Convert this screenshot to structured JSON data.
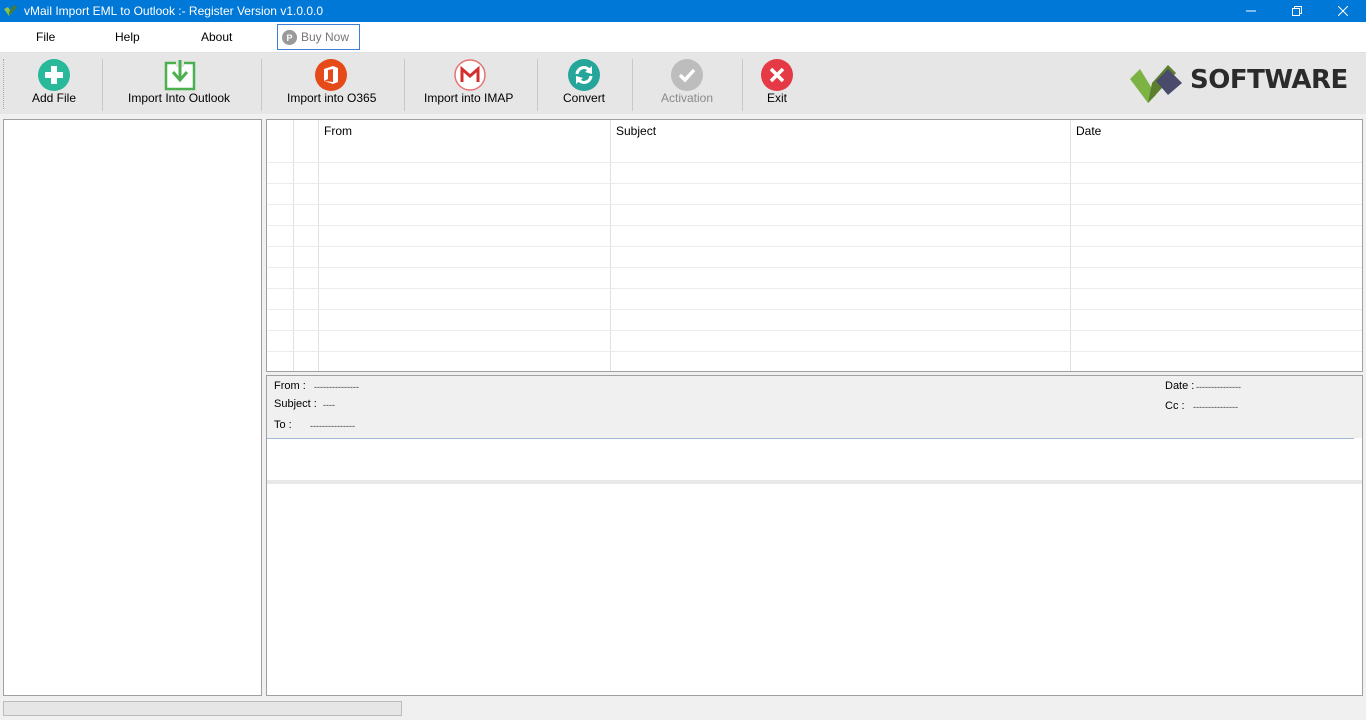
{
  "window": {
    "title": "vMail Import EML to Outlook :- Register Version v1.0.0.0",
    "accent": "#0078d7"
  },
  "menu": {
    "file": "File",
    "help": "Help",
    "about": "About",
    "buy_now": "Buy Now"
  },
  "toolbar": {
    "add_file": "Add File",
    "import_outlook": "Import Into Outlook",
    "import_o365": "Import into O365",
    "import_imap": "Import into IMAP",
    "convert": "Convert",
    "activation": "Activation",
    "exit": "Exit"
  },
  "brand": {
    "logo_text": "SOFTWARE"
  },
  "grid": {
    "columns": [
      "From",
      "Subject",
      "Date"
    ]
  },
  "preview": {
    "from_label": "From :",
    "from_value": "---------------",
    "subject_label": "Subject :",
    "subject_value": "----",
    "to_label": "To :",
    "to_value": "---------------",
    "date_label": "Date :",
    "date_value": "---------------",
    "cc_label": "Cc :",
    "cc_value": "---------------"
  },
  "status": {
    "progress": 0
  }
}
